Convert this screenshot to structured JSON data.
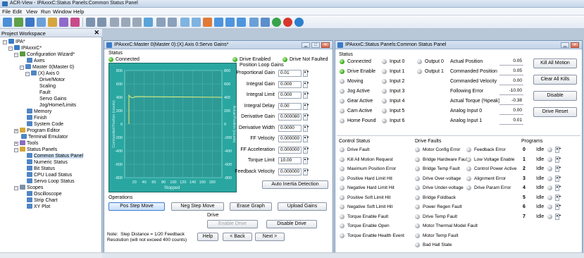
{
  "app": {
    "title": "ACR-View - IPAxxxC:Status Panels:Common Status Panel"
  },
  "menu": [
    "File",
    "Edit",
    "View",
    "Run",
    "Window",
    "Help"
  ],
  "workspace": {
    "title": "Project Workspace",
    "close": "✕",
    "nodes": [
      "IPA*",
      "IPAxxxC*",
      "Configuration Wizard*",
      "Axes",
      "Master 0(Master 0)",
      "(X) Axis 0",
      "Drive/Motor",
      "Scaling",
      "Fault",
      "Servo Gains",
      "Jog/Home/Limits",
      "Memory",
      "Finish",
      "System Code",
      "Program Editor",
      "Terminal Emulator",
      "Tools",
      "Status Panels",
      "Common Status Panel",
      "Numeric Status",
      "Bit Status",
      "CPU Load Status",
      "Servo Loop Status",
      "Scopes",
      "Oscilloscope",
      "Strip Chart",
      "XY Plot"
    ]
  },
  "gains": {
    "title": "IPAxxxC:Master 0(Master 0):(X) Axis 0:Servo Gains*",
    "status_label": "Status",
    "connected": "Connected",
    "drive_enabled": "Drive Enabled",
    "drive_not_faulted": "Drive Not Faulted",
    "loop_gains": "Position Loop Gains",
    "params": [
      {
        "label": "Proportional Gain",
        "value": "0.01"
      },
      {
        "label": "Integral Gain",
        "value": "0.000"
      },
      {
        "label": "Integral Limit",
        "value": "0.000"
      },
      {
        "label": "Integral Delay",
        "value": "0.00"
      },
      {
        "label": "Derivative Gain",
        "value": "0.000080"
      },
      {
        "label": "Derivative Width",
        "value": "0.0000"
      },
      {
        "label": "FF Velocity",
        "value": "0.000000"
      },
      {
        "label": "FF Acceleration",
        "value": "0.000000"
      },
      {
        "label": "Torque Limit",
        "value": "10.00"
      },
      {
        "label": "Feedback Velocity",
        "value": "0.000000"
      }
    ],
    "auto_inertia": "Auto Inertia Detection",
    "plot": {
      "y_left": [
        "800",
        "600",
        "400",
        "200",
        "0",
        "-200",
        "-400",
        "-600",
        "-800"
      ],
      "y_right": [
        "800",
        "600",
        "400",
        "200",
        "0",
        "-200",
        "-400",
        "-600",
        "-800"
      ],
      "x_ticks": [
        "20",
        "40",
        "60",
        "80",
        "100",
        "120",
        "140",
        "160",
        "180"
      ],
      "left_label": "Commanded Position (counts)",
      "right_label": "Actual Position (counts)",
      "state": "Stopped",
      "line_color": "#e8f07a"
    },
    "operations": "Operations",
    "pos_step": "Pos Step Move",
    "neg_step": "Neg Step Move",
    "erase": "Erase Graph",
    "upload": "Upload Gains",
    "drive_label": "Drive",
    "enable_drive": "Enable Drive",
    "disable_drive": "Disable Drive",
    "note": "Note:  Step Distance = 1/20 Feedback\nResolution (will not exceed 400 counts)",
    "help": "Help",
    "back": "< Back",
    "next": "Next >"
  },
  "csp": {
    "title": "IPAxxxC:Status Panels:Common Status Panel",
    "status_label": "Status",
    "status_items": [
      {
        "label": "Connected",
        "on": true
      },
      {
        "label": "Drive Enable",
        "on": true
      },
      {
        "label": "Moving",
        "on": false
      },
      {
        "label": "Jog Active",
        "on": false
      },
      {
        "label": "Gear Active",
        "on": false
      },
      {
        "label": "Cam Active",
        "on": false
      },
      {
        "label": "Home Found",
        "on": false
      }
    ],
    "inputs": [
      "Input 0",
      "Input 1",
      "Input 2",
      "Input 3",
      "Input 4",
      "Input 5",
      "Input 6"
    ],
    "outputs": [
      "Output 0",
      "Output 1"
    ],
    "readouts": [
      {
        "label": "Actual Position",
        "value": "0.05"
      },
      {
        "label": "Commanded Position",
        "value": "0.05"
      },
      {
        "label": "Commanded Velocity",
        "value": "0.00"
      },
      {
        "label": "Following Error",
        "value": "-10.00"
      },
      {
        "label": "Actual Torque (%peak)",
        "value": "-0.38"
      },
      {
        "label": "Analog Input 0",
        "value": "0.00"
      },
      {
        "label": "Analog Input 1",
        "value": "0.01"
      }
    ],
    "kill_all": "Kill All Motion",
    "clear_kills": "Clear All Kills",
    "disable": "Disable",
    "drive_reset": "Drive Reset",
    "control_status": "Control Status",
    "control_items": [
      "Drive Fault",
      "Kill All Motion Request",
      "Maximum Position Error",
      "Positive Hard Limit Hit",
      "Negative Hard Limit Hit",
      "Positive Soft Limit Hit",
      "Negative Soft Limit Hit",
      "Torque Enable Fault",
      "Torque Enable Open",
      "Torque Enable Health Event"
    ],
    "drive_faults": "Drive Faults",
    "faults_col1": [
      "Motor Config Error",
      "Bridge Hardware Fault",
      "Bridge Temp Fault",
      "Drive Over-voltage",
      "Drive Under-voltage",
      "Bridge Foldback",
      "Power Regen Fault",
      "Drive Temp Fault",
      "Motor Thermal Model Fault",
      "Motor Temp Fault",
      "Bad Hall State"
    ],
    "faults_col2": [
      "Feedback Error",
      "Low Voltage Enable",
      "Control Power Active",
      "Alignment Error",
      "Drive Param Error"
    ],
    "programs": "Programs",
    "program_ids": [
      "0",
      "1",
      "2",
      "3",
      "4",
      "5",
      "6",
      "7"
    ],
    "program_state": "Idle"
  }
}
